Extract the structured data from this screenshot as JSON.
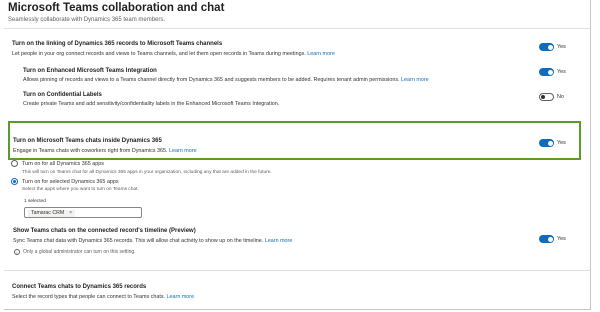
{
  "header": {
    "title": "Microsoft Teams collaboration and chat",
    "subtitle": "Seamlessly collaborate with Dynamics 365 team members."
  },
  "settings": {
    "linking": {
      "title": "Turn on the linking of Dynamics 365 records to Microsoft Teams channels",
      "description": "Let people in your org connect records and views to Teams channels, and let them open records in Teams during meetings.",
      "link": "Learn more",
      "state": "Yes"
    },
    "enhanced": {
      "title": "Turn on Enhanced Microsoft Teams Integration",
      "description": "Allows pinning of records and views to a Teams channel directly from Dynamics 365 and suggests members to be added. Requires tenant admin permissions.",
      "link": "Learn more",
      "state": "Yes"
    },
    "confidential": {
      "title": "Turn on Confidential Labels",
      "description": "Create private Teams and add sensitivity/confidentiality labels in the Enhanced Microsoft Teams Integration.",
      "state": "No"
    },
    "chats": {
      "title": "Turn on Microsoft Teams chats inside Dynamics 365",
      "description": "Engage in Teams chats with coworkers right from Dynamics 365.",
      "link": "Learn more",
      "state": "Yes"
    },
    "all_apps": {
      "label": "Turn on for all Dynamics 365 apps",
      "description": "This will turn on Teams chat for all Dynamics 365 apps in your organization, including any that are added in the future."
    },
    "selected_apps": {
      "label": "Turn on for selected Dynamics 365 apps",
      "description": "Select the apps where you want to turn on Teams chat.",
      "count_label": "1 selected",
      "chip": "Tamarac CRM",
      "chip_remove": "×"
    },
    "timeline": {
      "title": "Show Teams chats on the connected record's timeline (Preview)",
      "description": "Sync Teams chat data with Dynamics 365 records. This will allow chat activity to show up on the timeline.",
      "link": "Learn more",
      "note": "Only a global administrator can turn on this setting.",
      "state": "Yes"
    },
    "connect": {
      "title": "Connect Teams chats to Dynamics 365 records",
      "description": "Select the record types that people can connect to Teams chats.",
      "link": "Learn more"
    }
  },
  "colors": {
    "accent": "#0f6cbd",
    "highlight_border": "#5c9a29"
  },
  "icons": {
    "info": "info-icon",
    "remove": "close-icon"
  }
}
